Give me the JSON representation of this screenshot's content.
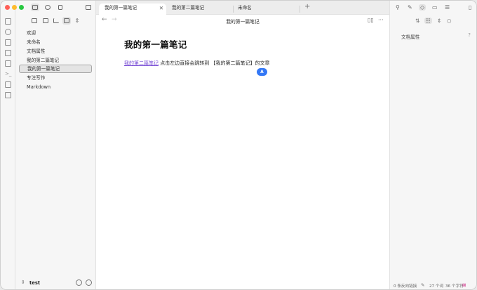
{
  "window_title": "我的第一篇笔记",
  "sidebar": {
    "files": [
      {
        "label": "欢迎",
        "active": false
      },
      {
        "label": "未命名",
        "active": false
      },
      {
        "label": "文档属性",
        "active": false
      },
      {
        "label": "我的第二篇笔记",
        "active": false
      },
      {
        "label": "我的第一篇笔记",
        "active": true
      },
      {
        "label": "专注写作",
        "active": false
      },
      {
        "label": "Markdown",
        "active": false
      }
    ],
    "vault_name": "test"
  },
  "tabs": [
    {
      "label": "我的第一篇笔记",
      "active": true
    },
    {
      "label": "我的第二篇笔记",
      "active": false
    },
    {
      "label": "未命名",
      "active": false
    }
  ],
  "editor": {
    "header_title": "我的第一篇笔记",
    "heading": "我的第一篇笔记",
    "link_text": "我的第二篇笔记",
    "body_text": " 点击左边直接会跳转到 【我的第二篇笔记】的文章",
    "cursor_badge": "A"
  },
  "right_panel": {
    "properties_label": "文档属性",
    "help_icon": "?"
  },
  "status": {
    "backlinks": "0 条反向链接",
    "words": "27 个词",
    "chars": "36 个字符"
  },
  "colors": {
    "accent": "#3478f6",
    "link": "#7a4fd6",
    "close": "#ff5f57",
    "minimize": "#febc2e",
    "zoom": "#28c840"
  }
}
